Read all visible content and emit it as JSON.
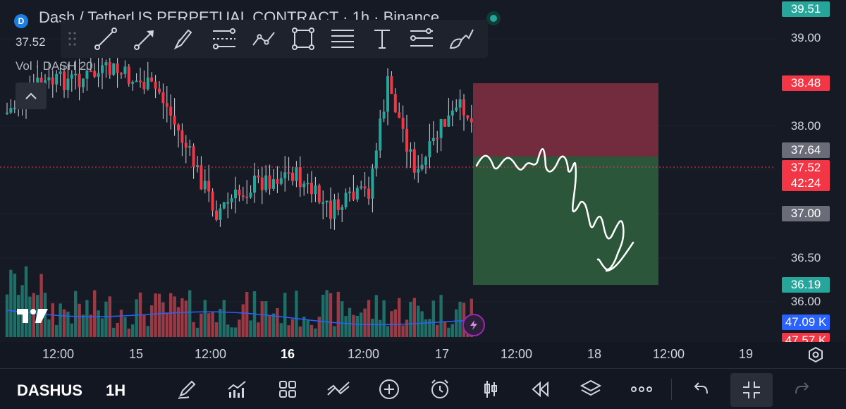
{
  "legend": {
    "title": "Dash / TetherUS PERPETUAL CONTRACT · 1h · Binance",
    "price": "37.52",
    "volume": "Vol · DASH 20"
  },
  "drawing_toolbar": {
    "icons": [
      "trend-line-icon",
      "arrow-icon",
      "brush-icon",
      "fib-retracement-icon",
      "path-icon",
      "rectangle-icon",
      "text-lines-icon",
      "text-icon",
      "long-position-icon",
      "eraser-icon"
    ]
  },
  "price_axis": {
    "labels": [
      "39.00",
      "38.00",
      "36.50",
      "36.00"
    ],
    "tags": [
      {
        "text": "39.51",
        "color": "#26a69a"
      },
      {
        "text": "38.48",
        "color": "#f23645"
      },
      {
        "text": "37.64",
        "color": "#6a6d78"
      },
      {
        "text": "37.52",
        "color": "#f23645"
      },
      {
        "text": "42:24",
        "color": "#f23645"
      },
      {
        "text": "37.00",
        "color": "#6a6d78"
      },
      {
        "text": "36.19",
        "color": "#26a69a"
      },
      {
        "text": "47.09 K",
        "color": "#2962ff"
      },
      {
        "text": "47.57 K",
        "color": "#f23645"
      }
    ]
  },
  "time_axis": {
    "labels": [
      "12:00",
      "15",
      "12:00",
      "16",
      "12:00",
      "17",
      "12:00",
      "18",
      "12:00",
      "19"
    ]
  },
  "position_tool": {
    "entry": 37.64,
    "stop": 38.48,
    "target": 36.19,
    "current": 37.52,
    "countdown": "42:24"
  },
  "bottom_bar": {
    "symbol": "DASHUS",
    "interval": "1H",
    "icons": [
      "pen-icon",
      "indicators-icon",
      "layouts-icon",
      "compare-icon",
      "add-icon",
      "alert-icon",
      "candle-type-icon",
      "replay-icon",
      "layers-icon",
      "more-icon",
      "undo-icon",
      "fullscreen-exit-icon",
      "redo-icon"
    ]
  },
  "colors": {
    "up": "#26a69a",
    "down": "#f23645",
    "background": "#161a25",
    "stop_zone": "#7c2f40",
    "target_zone": "#2f5d3c",
    "ma_line": "#2962ff"
  }
}
